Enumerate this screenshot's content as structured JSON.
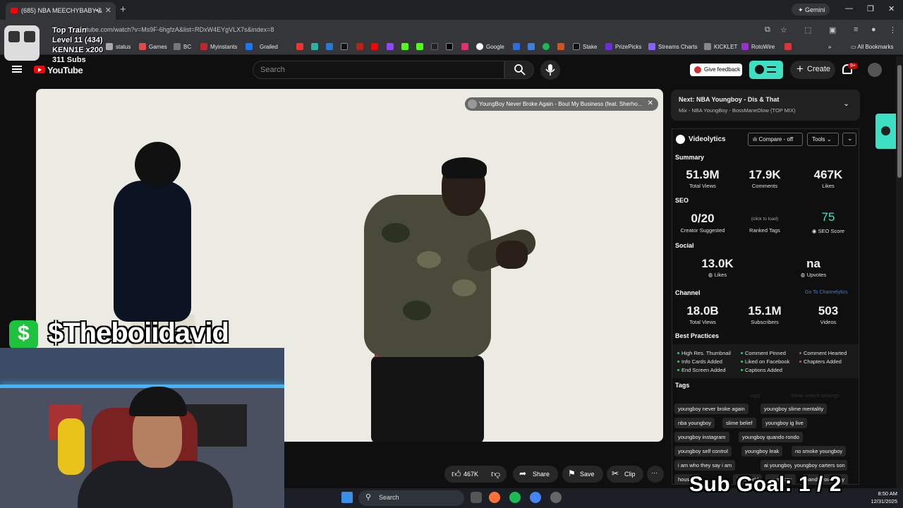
{
  "browser": {
    "tab_title": "(685) NBA MEECHYBABY &",
    "url": "youtube.com/watch?v=Ms9F-6hgfzA&list=RDxW4EYgVLX7s&index=8",
    "gemini_label": "Gemini",
    "bookmarks": [
      "status",
      "Games",
      "BC",
      "Myinstants",
      "Grailed",
      "Google",
      "Stake",
      "PrizePicks",
      "Streams Charts",
      "KICKLET",
      "RotoWire"
    ],
    "all_bookmarks": "All Bookmarks"
  },
  "youtube": {
    "logo_text": "YouTube",
    "search_placeholder": "Search",
    "give_feedback": "Give feedback",
    "create": "Create",
    "notif_count": "9+",
    "video_banner": "YoungBoy Never Broke Again - Bout My Business (feat. Sherho...",
    "actions": {
      "likes": "467K",
      "share": "Share",
      "save": "Save",
      "clip": "Clip",
      "more": "⋯"
    }
  },
  "overlay": {
    "train_title": "Top Train",
    "level": "Level 11  (434)",
    "kenn": "KENN1E x200",
    "subs": "311 Subs",
    "cashtag": "$Theboiidavid",
    "cash_symbol": "$",
    "sub_goal": "Sub Goal:  1 / 2"
  },
  "upnext": {
    "title": "Next: NBA Youngboy - Dis & That",
    "subtitle": "Mix - NBA YoungBoy - BossManeDlow (TOP MIX)"
  },
  "videolytics": {
    "brand": "Videolytics",
    "compare": "Compare - off",
    "tools": "Tools",
    "summary_label": "Summary",
    "summary": [
      {
        "value": "51.9M",
        "label": "Total Views"
      },
      {
        "value": "17.9K",
        "label": "Comments"
      },
      {
        "value": "467K",
        "label": "Likes"
      }
    ],
    "seo_label": "SEO",
    "seo": {
      "suggested_value": "0/20",
      "suggested_label": "Creator Suggested",
      "ranked_hint": "(click to load)",
      "ranked_label": "Ranked Tags",
      "score_value": "75",
      "score_label": "SEO Score"
    },
    "social_label": "Social",
    "social": {
      "likes_value": "13.0K",
      "likes_label": "Likes",
      "upvotes_value": "na",
      "upvotes_label": "Upvotes"
    },
    "channel_label": "Channel",
    "channel_link": "Go To Channelytics",
    "channel": [
      {
        "value": "18.0B",
        "label": "Total Views"
      },
      {
        "value": "15.1M",
        "label": "Subscribers"
      },
      {
        "value": "503",
        "label": "Videos"
      }
    ],
    "best_practices_label": "Best Practices",
    "best_practices": [
      {
        "text": "High Res. Thumbnail",
        "status": "good"
      },
      {
        "text": "Comment Pinned",
        "status": "good"
      },
      {
        "text": "Comment Hearted",
        "status": "bad"
      },
      {
        "text": "Info Cards Added",
        "status": "good"
      },
      {
        "text": "Liked on Facebook",
        "status": "good"
      },
      {
        "text": "Chapters Added",
        "status": "bad"
      },
      {
        "text": "End Screen Added",
        "status": "good"
      },
      {
        "text": "Captions Added",
        "status": "good"
      }
    ],
    "tags_label": "Tags",
    "tags_copy": "copy",
    "tags_rankings": "Show search rankings",
    "tags": [
      "youngboy never broke again",
      "youngboy slime mentality",
      "nba youngboy",
      "slime belief",
      "youngboy ig live",
      "youngboy instagram",
      "youngboy quando rondo",
      "youngboy self control",
      "youngboy leak",
      "no smoke youngboy",
      "i am who they say i am",
      "ai youngboy 2",
      "youngboy carters son",
      "houston",
      "juice wrld",
      "youngboy",
      "bandit youngboy"
    ]
  },
  "taskbar": {
    "search": "Search",
    "time": "8:50 AM",
    "date": "12/31/2025"
  },
  "colors": {
    "accent_teal": "#3ee0c4",
    "youtube_red": "#ff0000",
    "cashapp_green": "#1ec23c"
  }
}
